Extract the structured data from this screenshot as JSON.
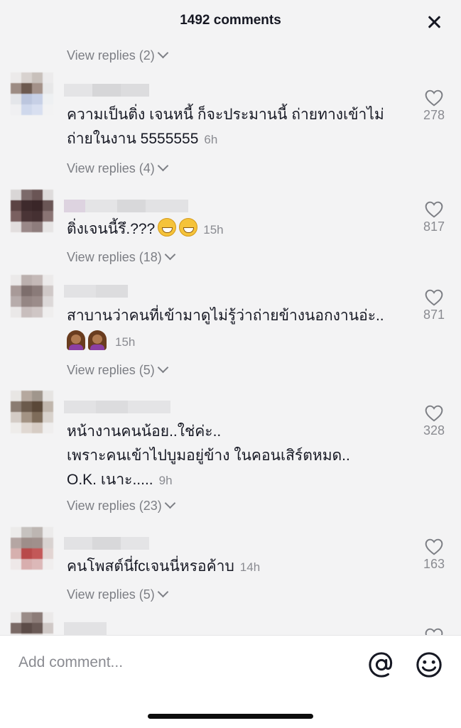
{
  "header": {
    "title": "1492 comments",
    "close_icon": "close-icon"
  },
  "view_replies": [
    "View replies (2)",
    "View replies (4)",
    "View replies (18)",
    "View replies (5)",
    "View replies (23)",
    "View replies (5)"
  ],
  "comments": [
    {
      "line1": "ความเป็นติ่ง เจนหนี้ ก็จะประมานนี้ ถ่ายทางเข้าไม่",
      "line2": "ถ่ายในงาน 5555555",
      "time": "6h",
      "likes": "278"
    },
    {
      "line1": "ติ่งเจนนี้รึ.???",
      "time": "15h",
      "likes": "817"
    },
    {
      "line1": "สาบานว่าคนที่เข้ามาดูไม่รู้ว่าถ่ายข้างนอกงานอ่ะ..",
      "time": "15h",
      "likes": "871"
    },
    {
      "line1": "หน้างานคนน้อย..ใช่ค่ะ..",
      "line2": "เพราะคนเข้าไปบูมอยู่ข้าง ในคอนเสิร์ตหมด..",
      "line3": "O.K. เนาะ.....",
      "time": "9h",
      "likes": "328"
    },
    {
      "line1": "คนโพสต์นี่fcเจนนี่หรอค้าบ",
      "time": "14h",
      "likes": "163"
    }
  ],
  "input": {
    "placeholder": "Add comment...",
    "mention_icon": "at-icon",
    "emoji_icon": "emoji-icon"
  },
  "colors": {
    "background": "#f3f3f4",
    "text": "#161823",
    "secondary": "#7c7e84"
  }
}
